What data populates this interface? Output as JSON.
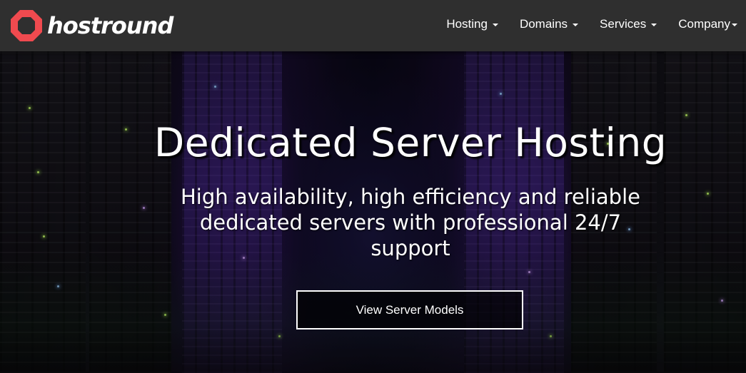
{
  "brand": {
    "name": "hostround",
    "logo_icon": "red-octagon-ring-icon",
    "accent_color": "#f04a4f"
  },
  "nav": {
    "items": [
      {
        "label": "Hosting",
        "icon": "caret-down-icon"
      },
      {
        "label": "Domains",
        "icon": "caret-down-icon"
      },
      {
        "label": "Services",
        "icon": "caret-down-icon"
      },
      {
        "label": "Company",
        "icon": "caret-down-icon"
      }
    ]
  },
  "hero": {
    "title": "Dedicated Server Hosting",
    "subtitle": "High availability, high efficiency and reliable dedicated servers with professional 24/7 support",
    "cta_label": "View Server Models"
  },
  "colors": {
    "navbar_bg": "#2f2f2f",
    "text": "#ffffff"
  }
}
